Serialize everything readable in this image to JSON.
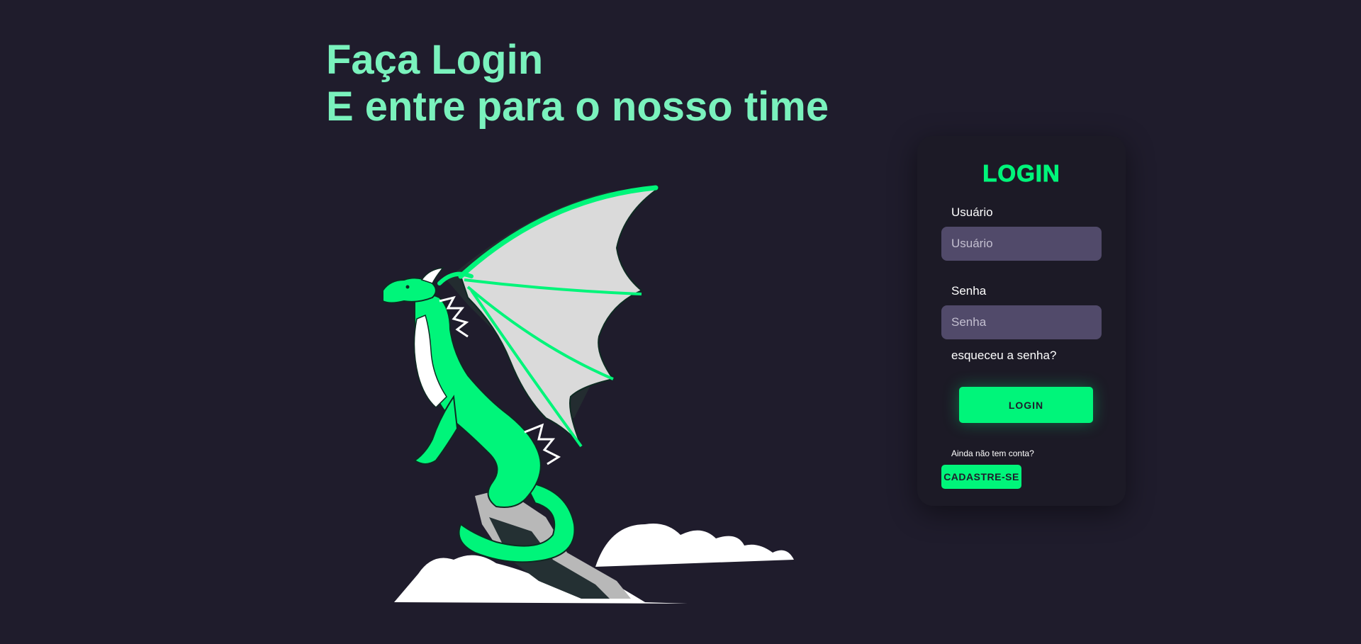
{
  "hero": {
    "line1": "Faça Login",
    "line2": "E entre para o nosso time",
    "illustration": "dragon-illustration"
  },
  "login_card": {
    "title": "LOGIN",
    "username": {
      "label": "Usuário",
      "placeholder": "Usuário",
      "value": ""
    },
    "password": {
      "label": "Senha",
      "placeholder": "Senha",
      "value": ""
    },
    "forgot_password": "esqueceu a senha?",
    "login_button": "LOGIN",
    "signup_prompt": "Ainda não tem conta?",
    "signup_button": "CADASTRE-SE"
  },
  "colors": {
    "background": "#1f1c2c",
    "card": "#1c1a26",
    "accent": "#00f57a",
    "headline": "#7af2bd",
    "input": "#514a6a"
  }
}
